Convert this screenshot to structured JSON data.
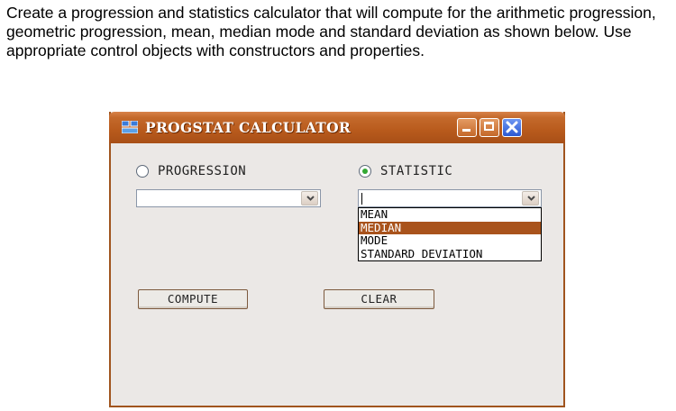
{
  "instructions": "Create a progression and statistics calculator that will compute for the arithmetic progression, geometric progression, mean, median mode and standard deviation as shown below. Use appropriate control objects with constructors and properties.",
  "window": {
    "title": "PROGSTAT CALCULATOR",
    "icon": "app-window-icon",
    "controls": [
      "minimize-icon",
      "maximize-icon",
      "close-icon"
    ]
  },
  "progression": {
    "label": "PROGRESSION",
    "checked": false,
    "combo_value": ""
  },
  "statistic": {
    "label": "STATISTIC",
    "checked": true,
    "combo_value": "",
    "options": [
      "MEAN",
      "MEDIAN",
      "MODE",
      "STANDARD DEVIATION"
    ],
    "highlighted": "MEDIAN"
  },
  "buttons": {
    "compute": "COMPUTE",
    "clear": "CLEAR"
  },
  "colors": {
    "titlebar": "#b85a1c",
    "highlight": "#a9531c",
    "radio_dot": "#33a833",
    "close": "#2c58d2"
  }
}
